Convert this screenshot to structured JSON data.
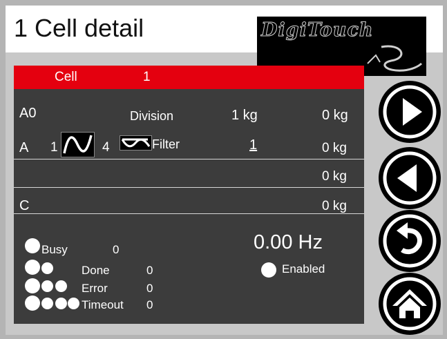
{
  "header": {
    "title": "1 Cell detail",
    "logo_text": "DigiTouch"
  },
  "cell_bar": {
    "label": "Cell",
    "value": "1"
  },
  "rows": {
    "a0": {
      "label": "A0",
      "division_label": "Division",
      "division_value": "1 kg",
      "weight": "0 kg"
    },
    "a": {
      "label": "A",
      "range_from": "1",
      "range_to": "4",
      "filter_label": "Filter",
      "filter_value": "1",
      "weight": "0 kg"
    },
    "b": {
      "weight": "0 kg"
    },
    "c": {
      "label": "C",
      "weight": "0 kg"
    }
  },
  "status": {
    "busy": {
      "label": "Busy",
      "value": "0"
    },
    "done": {
      "label": "Done",
      "value": "0"
    },
    "error": {
      "label": "Error",
      "value": "0"
    },
    "timeout": {
      "label": "Timeout",
      "value": "0"
    },
    "frequency": "0.00 Hz",
    "enabled_label": "Enabled"
  },
  "nav": [
    "play-icon",
    "back-icon",
    "return-icon",
    "home-icon"
  ],
  "colors": {
    "accent": "#e4000f",
    "panel": "#3c3c3c",
    "background": "#c8c8c8"
  }
}
